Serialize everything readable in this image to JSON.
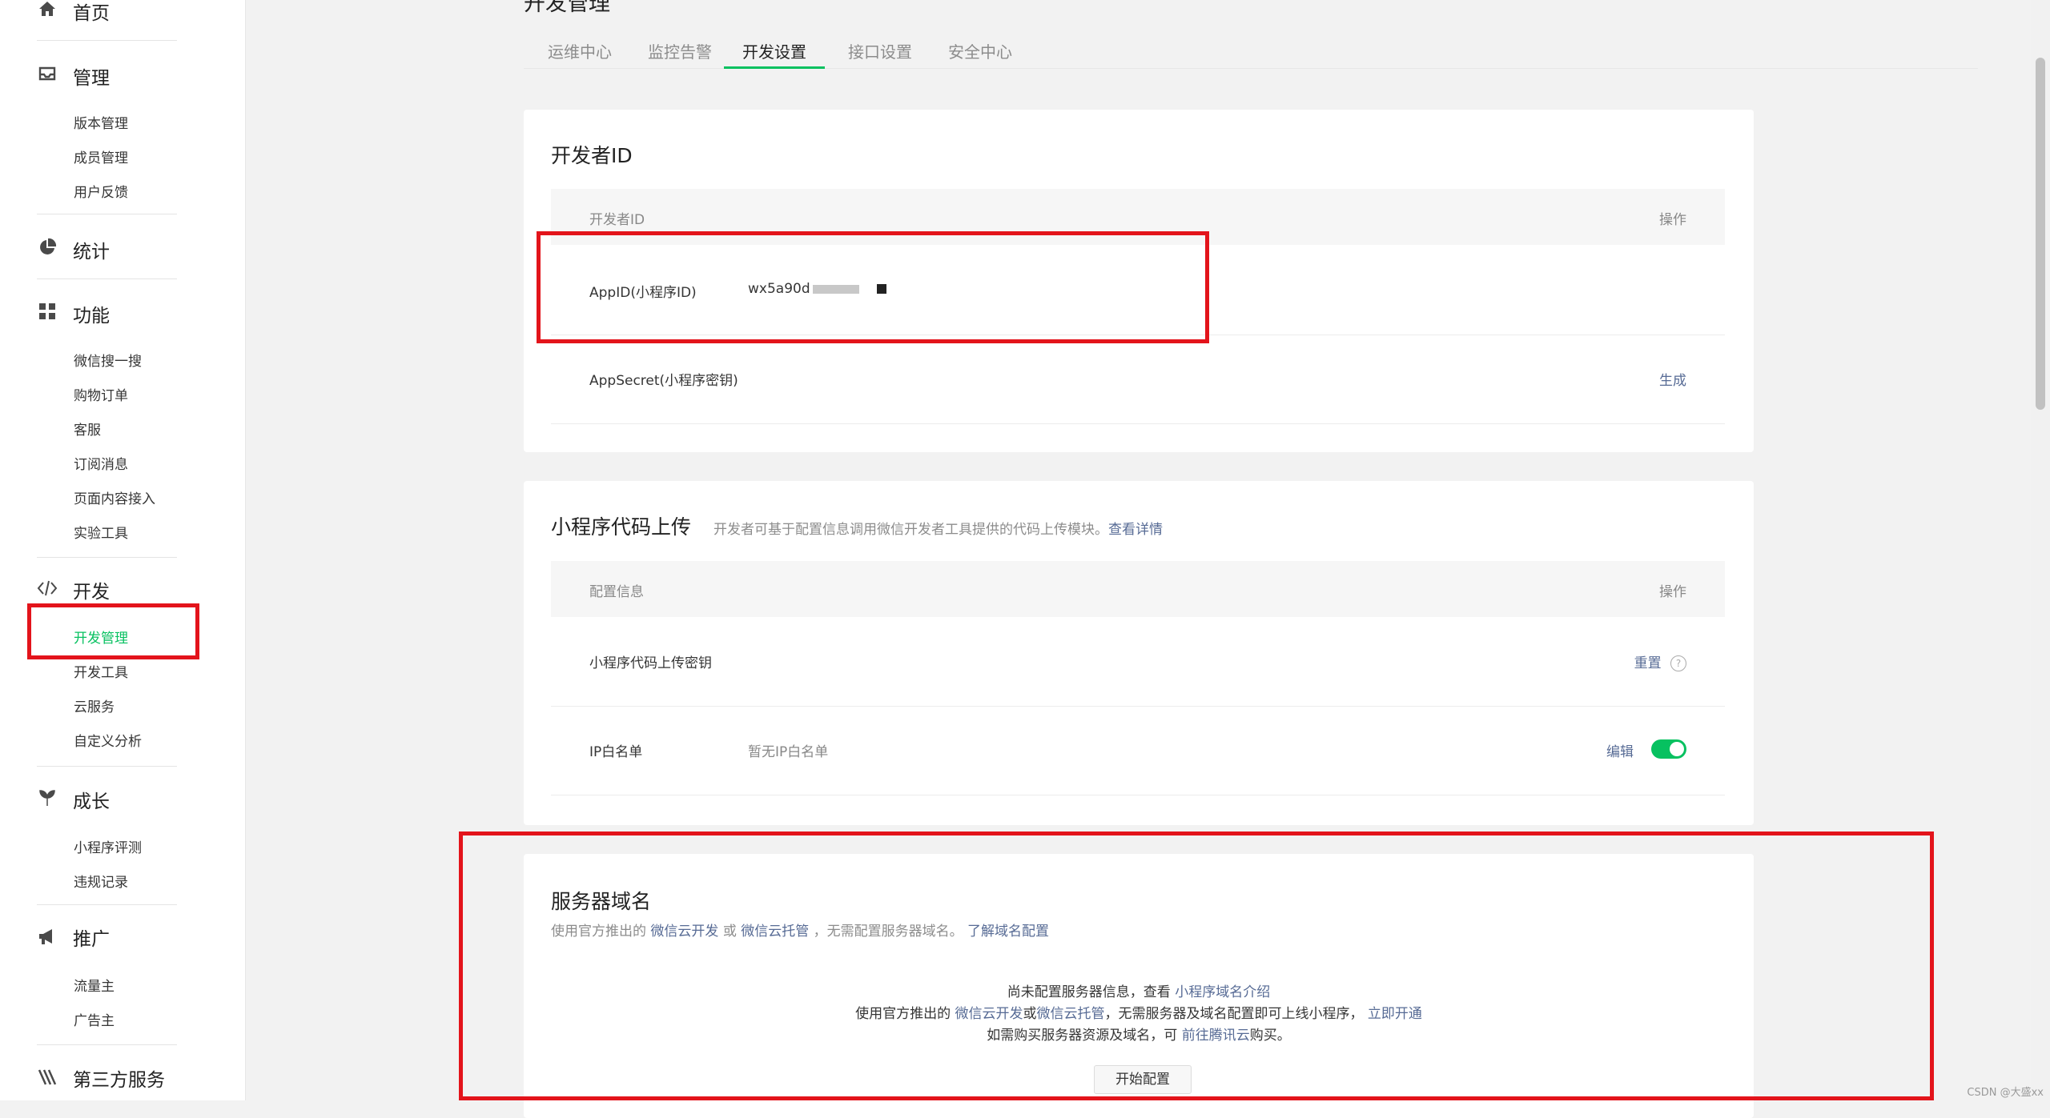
{
  "sidebar": {
    "home": "首页",
    "manage": {
      "title": "管理",
      "items": [
        "版本管理",
        "成员管理",
        "用户反馈"
      ]
    },
    "stats": "统计",
    "features": {
      "title": "功能",
      "items": [
        "微信搜一搜",
        "购物订单",
        "客服",
        "订阅消息",
        "页面内容接入",
        "实验工具"
      ]
    },
    "dev": {
      "title": "开发",
      "items": [
        "开发管理",
        "开发工具",
        "云服务",
        "自定义分析"
      ]
    },
    "growth": {
      "title": "成长",
      "items": [
        "小程序评测",
        "违规记录"
      ]
    },
    "promo": {
      "title": "推广",
      "items": [
        "流量主",
        "广告主"
      ]
    },
    "third": "第三方服务"
  },
  "page_title": "开发管理",
  "tabs": [
    "运维中心",
    "监控告警",
    "开发设置",
    "接口设置",
    "安全中心"
  ],
  "dev_id_card": {
    "title": "开发者ID",
    "col_left": "开发者ID",
    "col_right": "操作",
    "appid_label": "AppID(小程序ID)",
    "appid_value": "wx5a90d",
    "appsecret_label": "AppSecret(小程序密钥)",
    "generate": "生成"
  },
  "upload_card": {
    "title": "小程序代码上传",
    "desc": "开发者可基于配置信息调用微信开发者工具提供的代码上传模块。",
    "desc_link": "查看详情",
    "col_left": "配置信息",
    "col_right": "操作",
    "key_label": "小程序代码上传密钥",
    "reset": "重置",
    "ip_label": "IP白名单",
    "ip_value": "暂无IP白名单",
    "edit": "编辑",
    "ip_toggle_on": true
  },
  "server_card": {
    "title": "服务器域名",
    "sub_pre": "使用官方推出的",
    "sub_link1": "微信云开发",
    "sub_or": "或",
    "sub_link2": "微信云托管",
    "sub_post": "，无需配置服务器域名。",
    "sub_link3": "了解域名配置",
    "l1_pre": "尚未配置服务器信息，查看",
    "l1_link": "小程序域名介绍",
    "l2_pre": "使用官方推出的",
    "l2_link1": "微信云开发",
    "l2_or": "或",
    "l2_link2": "微信云托管",
    "l2_post": "，无需服务器及域名配置即可上线小程序，",
    "l2_link3": "立即开通",
    "l3_pre": "如需购买服务器资源及域名，可",
    "l3_link": "前往腾讯云",
    "l3_post": "购买。",
    "button": "开始配置"
  },
  "watermark": "CSDN @大盛xx",
  "colors": {
    "accent": "#07c160",
    "link": "#576b95",
    "highlight": "#e3141b"
  }
}
